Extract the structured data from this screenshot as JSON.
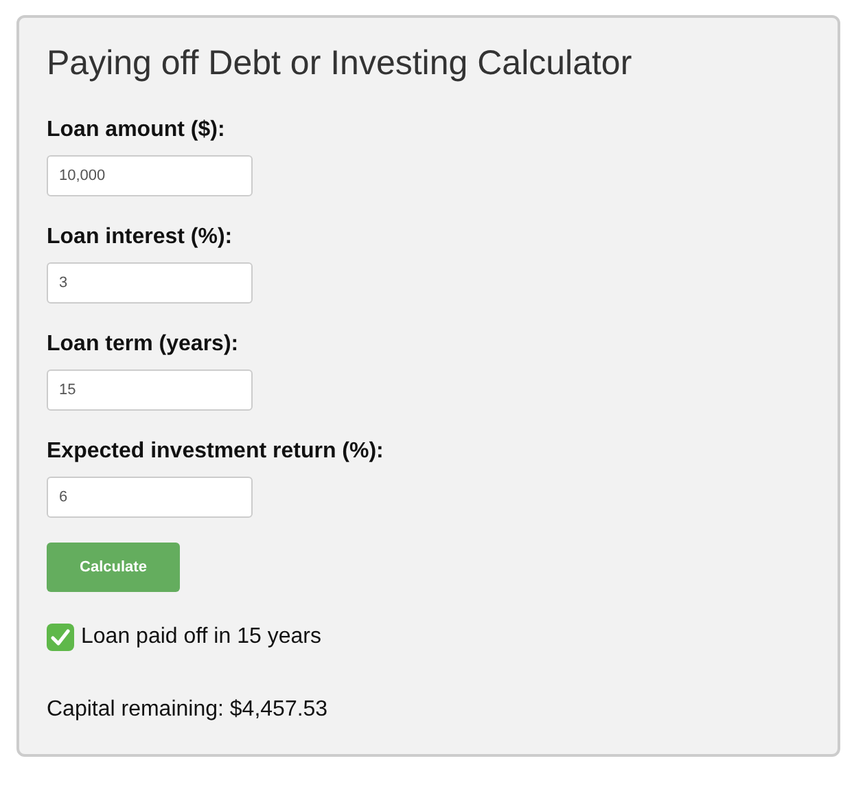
{
  "title": "Paying off Debt or Investing Calculator",
  "fields": [
    {
      "label": "Loan amount ($):",
      "value": "10,000"
    },
    {
      "label": "Loan interest (%):",
      "value": "3"
    },
    {
      "label": "Loan term (years):",
      "value": "15"
    },
    {
      "label": "Expected investment return (%):",
      "value": "6"
    }
  ],
  "button": "Calculate",
  "result": {
    "kind": "success",
    "text": "Loan paid off in 15 years"
  },
  "summary": "Capital remaining: $4,457.53"
}
